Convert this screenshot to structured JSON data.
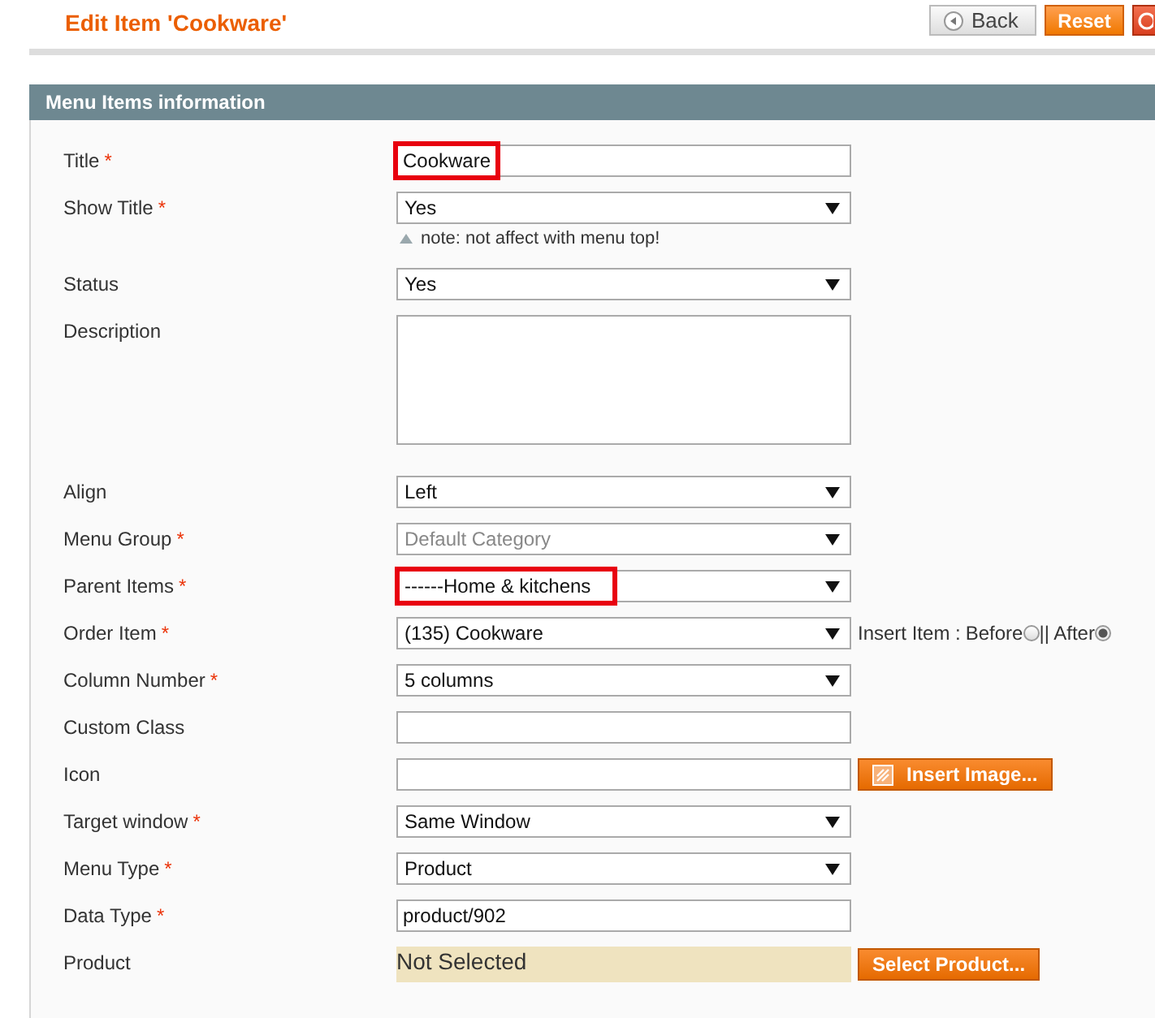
{
  "header": {
    "title": "Edit Item 'Cookware'",
    "buttons": [
      {
        "kind": "back",
        "label": "Back"
      },
      {
        "kind": "primary",
        "label": "Reset"
      },
      {
        "kind": "cut"
      }
    ]
  },
  "section": {
    "title": "Menu Items information"
  },
  "fields": [
    {
      "label": "Title",
      "required_mark": "*",
      "kind": "text",
      "value": "Cookware",
      "highlighted": true
    },
    {
      "label": "Show Title",
      "required_mark": "*",
      "kind": "select",
      "value": "Yes",
      "note": "note: not affect with menu top!"
    },
    {
      "label": "Status",
      "kind": "select",
      "value": "Yes"
    },
    {
      "label": "Description",
      "kind": "textarea"
    },
    {
      "label": "Align",
      "kind": "select",
      "value": "Left"
    },
    {
      "label": "Menu Group",
      "required_mark": "*",
      "kind": "select",
      "value": "Default Category",
      "disabled": true
    },
    {
      "label": "Parent Items",
      "required_mark": "*",
      "kind": "select",
      "value": "------Home & kitchens",
      "highlighted": true
    },
    {
      "label": "Order Item",
      "required_mark": "*",
      "kind": "select",
      "value": "(135) Cookware",
      "insert": {
        "label": "Insert Item :",
        "options": [
          {
            "label": "Before",
            "selected": false
          },
          {
            "label": "|| After",
            "selected": true
          }
        ]
      }
    },
    {
      "label": "Column Number",
      "required_mark": "*",
      "kind": "select",
      "value": "5 columns"
    },
    {
      "label": "Custom Class",
      "kind": "text"
    },
    {
      "label": "Icon",
      "kind": "text",
      "button": "Insert Image..."
    },
    {
      "label": "Target window",
      "required_mark": "*",
      "kind": "select",
      "value": "Same Window"
    },
    {
      "label": "Menu Type",
      "required_mark": "*",
      "kind": "select",
      "value": "Product"
    },
    {
      "label": "Data Type",
      "required_mark": "*",
      "kind": "text",
      "value": "product/902"
    },
    {
      "label": "Product",
      "kind": "product",
      "value": "Not Selected",
      "button": "Select Product..."
    }
  ]
}
